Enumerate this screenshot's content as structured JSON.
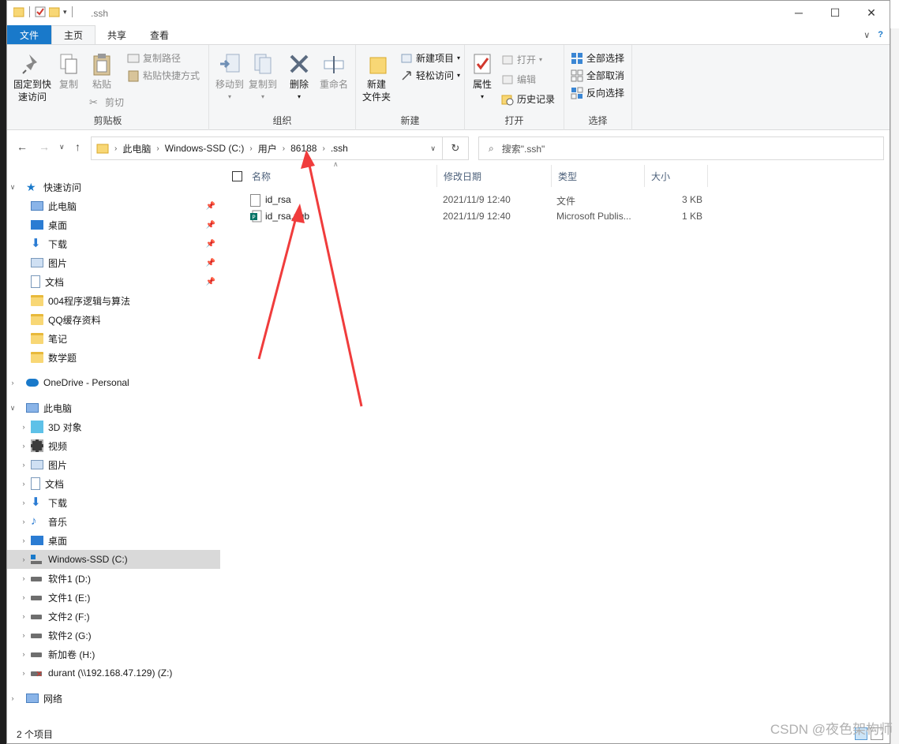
{
  "window": {
    "title": ".ssh",
    "controls": {
      "minimize": "─",
      "maximize": "☐",
      "close": "✕"
    }
  },
  "tabs": [
    "文件",
    "主页",
    "共享",
    "查看"
  ],
  "ribbon": {
    "clipboard": {
      "pin": "固定到快速访问",
      "copy": "复制",
      "paste": "粘贴",
      "copy_path": "复制路径",
      "paste_shortcut": "粘贴快捷方式",
      "cut": "剪切",
      "label": "剪贴板"
    },
    "organize": {
      "move_to": "移动到",
      "copy_to": "复制到",
      "delete": "删除",
      "rename": "重命名",
      "label": "组织"
    },
    "new": {
      "new_folder": "新建\n文件夹",
      "new_item": "新建项目",
      "easy_access": "轻松访问",
      "label": "新建"
    },
    "open": {
      "properties": "属性",
      "open": "打开",
      "edit": "编辑",
      "history": "历史记录",
      "label": "打开"
    },
    "select": {
      "select_all": "全部选择",
      "select_none": "全部取消",
      "invert": "反向选择",
      "label": "选择"
    }
  },
  "address": {
    "crumbs": [
      "此电脑",
      "Windows-SSD (C:)",
      "用户",
      "86188",
      ".ssh"
    ],
    "search_placeholder": "搜索\".ssh\""
  },
  "nav": {
    "quick_access": "快速访问",
    "quick_items": [
      "此电脑",
      "桌面",
      "下载",
      "图片",
      "文档",
      "004程序逻辑与算法",
      "QQ缓存资料",
      "笔记",
      "数学题"
    ],
    "onedrive": "OneDrive - Personal",
    "this_pc": "此电脑",
    "pc_items": [
      "3D 对象",
      "视频",
      "图片",
      "文档",
      "下载",
      "音乐",
      "桌面",
      "Windows-SSD (C:)",
      "软件1 (D:)",
      "文件1 (E:)",
      "文件2 (F:)",
      "软件2 (G:)",
      "新加卷 (H:)",
      "durant (\\\\192.168.47.129) (Z:)"
    ],
    "network": "网络"
  },
  "columns": {
    "name": "名称",
    "modified": "修改日期",
    "type": "类型",
    "size": "大小"
  },
  "files": [
    {
      "name": "id_rsa",
      "modified": "2021/11/9 12:40",
      "type": "文件",
      "size": "3 KB"
    },
    {
      "name": "id_rsa.pub",
      "modified": "2021/11/9 12:40",
      "type": "Microsoft Publis...",
      "size": "1 KB"
    }
  ],
  "status": "2 个项目",
  "watermark": "CSDN @夜色架构师",
  "colors": {
    "file_tab": "#1979ca",
    "annotation_arrow": "#f03c3c",
    "selected_row": "#d9d9d9"
  }
}
